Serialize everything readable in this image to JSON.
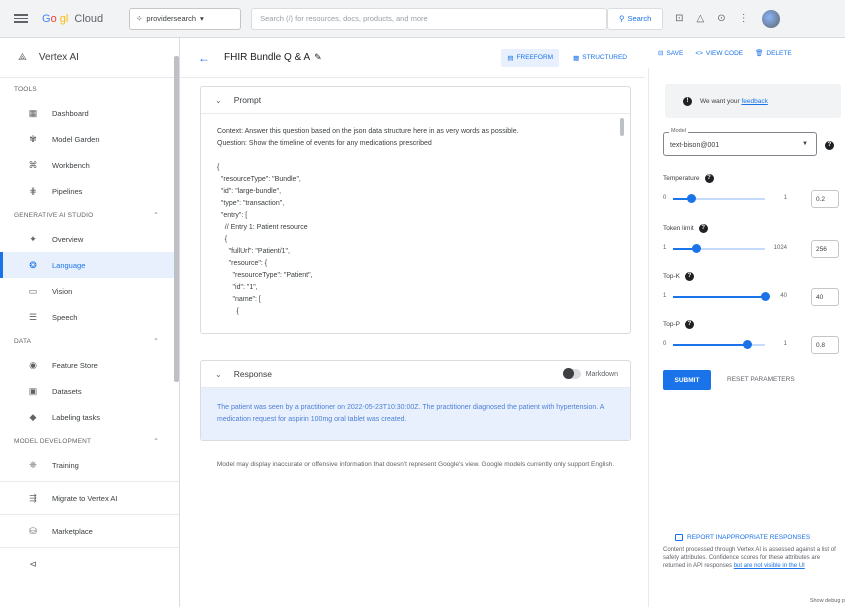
{
  "topbar": {
    "logo_g": "G",
    "logo_o1": "o",
    "logo_o2": "gl",
    "logo_rest": "Cloud",
    "project": "providersearch",
    "search_placeholder": "Search (/) for resources, docs, products, and more",
    "search_button": "Search"
  },
  "sidebar": {
    "product": "Vertex AI",
    "sections": [
      {
        "label": "TOOLS"
      },
      {
        "label": "GENERATIVE AI STUDIO"
      },
      {
        "label": "DATA"
      },
      {
        "label": "MODEL DEVELOPMENT"
      }
    ],
    "tools": [
      "Dashboard",
      "Model Garden",
      "Workbench",
      "Pipelines"
    ],
    "genai": [
      "Overview",
      "Language",
      "Vision",
      "Speech"
    ],
    "data": [
      "Feature Store",
      "Datasets",
      "Labeling tasks"
    ],
    "model_dev": [
      "Training"
    ],
    "bottom": [
      "Migrate to Vertex AI",
      "Marketplace"
    ],
    "collapse": "⊲"
  },
  "main": {
    "title": "FHIR Bundle Q & A",
    "freeform": "FREEFORM",
    "structured": "STRUCTURED",
    "prompt_label": "Prompt",
    "prompt_lines": [
      "Context: Answer this question based on the json data structure here in as very words as possible.",
      "Question: Show the timeline of events for any medications prescribed",
      "",
      "{",
      "  \"resourceType\": \"Bundle\",",
      "  \"id\": \"large-bundle\",",
      "  \"type\": \"transaction\",",
      "  \"entry\": [",
      "    // Entry 1: Patient resource",
      "    {",
      "      \"fullUrl\": \"Patient/1\",",
      "      \"resource\": {",
      "        \"resourceType\": \"Patient\",",
      "        \"id\": \"1\",",
      "        \"name\": [",
      "          {"
    ],
    "response_label": "Response",
    "markdown_label": "Markdown",
    "response_text": "The patient was seen by a practitioner on 2022-05-23T10:30:00Z. The practitioner diagnosed the patient with hypertension. A medication request for aspirin 100mg oral tablet was created.",
    "disclaimer": "Model may display inaccurate or offensive information that doesn't represent Google's view. Google models currently only support English."
  },
  "right": {
    "save": "SAVE",
    "view_code": "VIEW CODE",
    "delete": "DELETE",
    "feedback_text": "We want your",
    "feedback_link": "feedback",
    "model_label": "Model",
    "model_value": "text-bison@001",
    "params": [
      {
        "label": "Temperature",
        "min": "0",
        "max": "1",
        "value": "0.2",
        "fraction": 0.2
      },
      {
        "label": "Token limit",
        "min": "1",
        "max": "1024",
        "value": "256",
        "fraction": 0.25
      },
      {
        "label": "Top-K",
        "min": "1",
        "max": "40",
        "value": "40",
        "fraction": 1.0
      },
      {
        "label": "Top-P",
        "min": "0",
        "max": "1",
        "value": "0.8",
        "fraction": 0.8
      }
    ],
    "submit": "SUBMIT",
    "reset": "RESET PARAMETERS",
    "report": "REPORT INAPPROPRIATE RESPONSES",
    "safety_text": "Content processed through Vertex AI is assessed against a list of safety attributes. Confidence scores for these attributes are returned in API responses",
    "safety_link": "but are not visible in the UI",
    "debug": "Show debug p"
  }
}
